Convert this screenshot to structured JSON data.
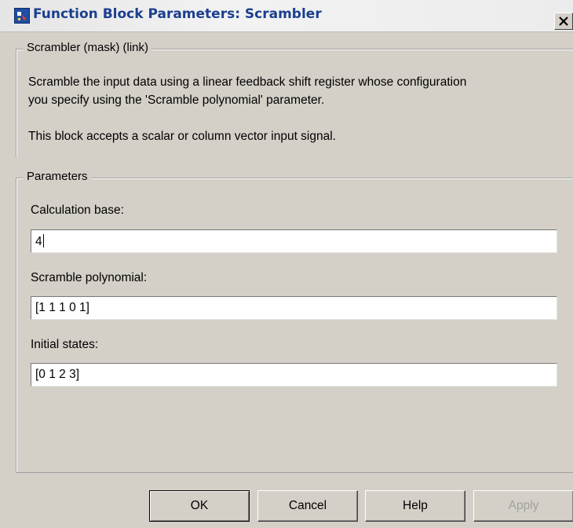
{
  "window": {
    "title": "Function Block Parameters: Scrambler",
    "close_glyph": "X"
  },
  "mask_group": {
    "legend": "Scrambler (mask) (link)",
    "description_line1": "Scramble the input data using a linear feedback shift register whose configuration",
    "description_line2": "you specify using the 'Scramble polynomial' parameter.",
    "description_line3": "This block accepts a scalar or column vector input signal."
  },
  "parameters_group": {
    "legend": "Parameters",
    "fields": [
      {
        "label": "Calculation base:",
        "value": "4"
      },
      {
        "label": "Scramble polynomial:",
        "value": "[1 1 1 0 1]"
      },
      {
        "label": "Initial states:",
        "value": "[0 1 2 3]"
      }
    ]
  },
  "buttons": {
    "ok": "OK",
    "cancel": "Cancel",
    "help": "Help",
    "apply": "Apply"
  },
  "icons": {
    "app": "simulink-block-icon",
    "close": "close-icon"
  },
  "colors": {
    "title_text": "#1b3f8f",
    "dialog_background": "#d4d0c8",
    "disabled_text": "#a0a0a0"
  }
}
